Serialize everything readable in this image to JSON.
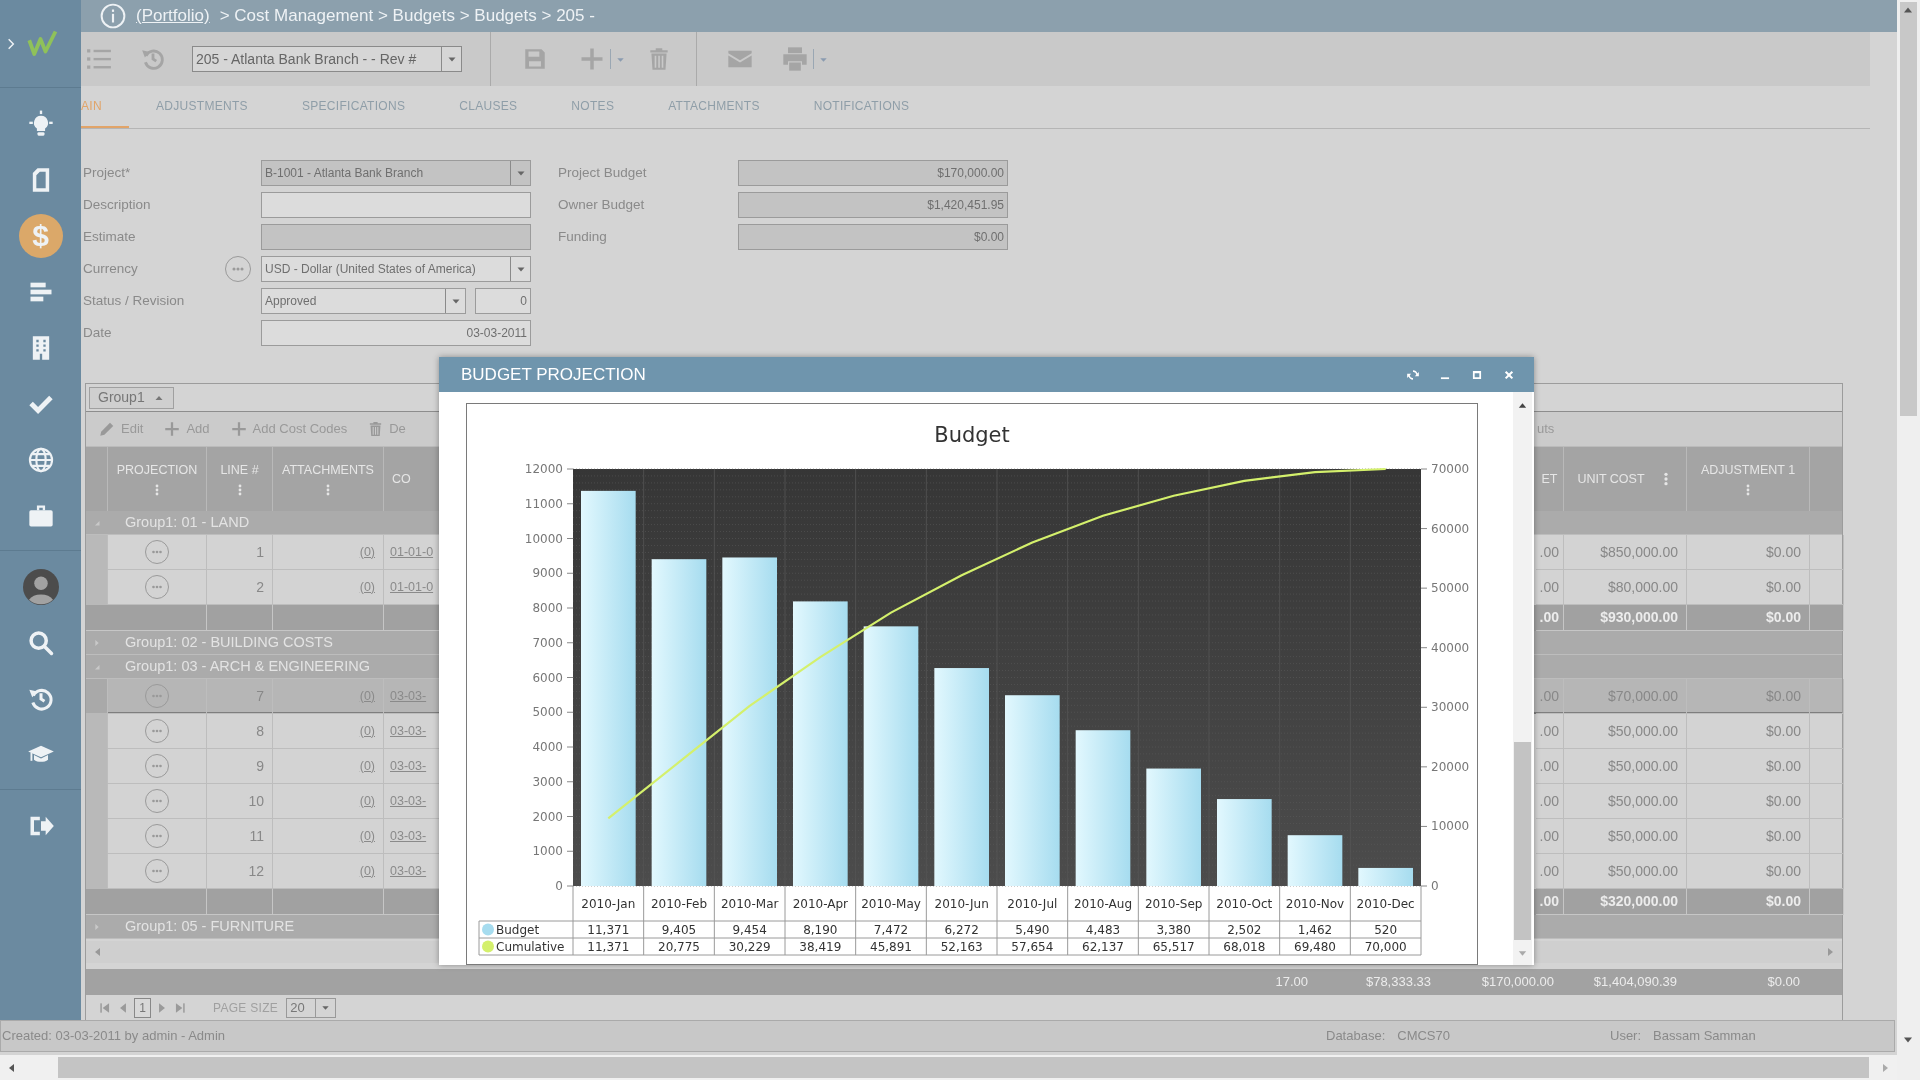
{
  "sidebar": {
    "sections": [
      {
        "items": [
          {
            "kind": "lightbulb",
            "selected": false
          },
          {
            "kind": "document",
            "selected": false
          },
          {
            "kind": "dollar",
            "glyph": "$",
            "selected": true
          },
          {
            "kind": "bars",
            "selected": false
          },
          {
            "kind": "building",
            "selected": false
          },
          {
            "kind": "check",
            "selected": false
          },
          {
            "kind": "globe",
            "selected": false
          },
          {
            "kind": "briefcase",
            "selected": false
          }
        ]
      },
      {
        "items": [
          {
            "kind": "avatar",
            "selected": false
          },
          {
            "kind": "search",
            "selected": false
          },
          {
            "kind": "history",
            "selected": false
          },
          {
            "kind": "cap",
            "selected": false
          }
        ]
      },
      {
        "items": [
          {
            "kind": "signout",
            "selected": false
          }
        ]
      }
    ]
  },
  "header": {
    "link": "(Portfolio)",
    "trail": "> Cost Management > Budgets > Budgets > 205 -"
  },
  "toolbar": {
    "record": "205 - Atlanta Bank Branch -  - Rev #"
  },
  "tabs": [
    {
      "label": "AIN",
      "selected": true
    },
    {
      "label": "ADJUSTMENTS",
      "selected": false
    },
    {
      "label": "SPECIFICATIONS",
      "selected": false
    },
    {
      "label": "CLAUSES",
      "selected": false
    },
    {
      "label": "NOTES",
      "selected": false
    },
    {
      "label": "ATTACHMENTS",
      "selected": false
    },
    {
      "label": "NOTIFICATIONS",
      "selected": false
    }
  ],
  "form": {
    "left": [
      {
        "label": "Project*",
        "kind": "select",
        "value": "B-1001 - Atlanta Bank Branch",
        "disabled": true
      },
      {
        "label": "Description",
        "kind": "text",
        "disabled": false
      },
      {
        "label": "Estimate",
        "kind": "text",
        "disabled": true
      },
      {
        "label": "Currency",
        "kind": "lookup",
        "value": "USD - Dollar (United States of America)",
        "disabled": false
      },
      {
        "label": "Status / Revision",
        "kind": "status",
        "value": "Approved",
        "revision": "0",
        "disabled": false
      },
      {
        "label": "Date",
        "kind": "date",
        "value": "03-03-2011",
        "disabled": false
      }
    ],
    "right": [
      {
        "label": "Project Budget",
        "value": "$170,000.00",
        "disabled": true
      },
      {
        "label": "Owner Budget",
        "value": "$1,420,451.95",
        "disabled": true
      },
      {
        "label": "Funding",
        "value": "$0.00",
        "disabled": true
      }
    ]
  },
  "grid": {
    "group_chip": "Group1",
    "toolbar": [
      {
        "kind": "pencil",
        "label": "Edit"
      },
      {
        "kind": "plus",
        "label": "Add"
      },
      {
        "kind": "plus",
        "label": "Add Cost Codes"
      },
      {
        "kind": "trash",
        "label": "De"
      }
    ],
    "toolbar_right": "uts",
    "columns": [
      {
        "label": "PROJECTION",
        "kind": "stacked"
      },
      {
        "label": "LINE #",
        "kind": "stacked"
      },
      {
        "label": "ATTACHMENTS",
        "kind": "stacked"
      },
      {
        "label": "CO",
        "kind": "plain"
      },
      {
        "label": "ET",
        "kind": "plain"
      },
      {
        "label": "UNIT COST",
        "kind": "inline"
      },
      {
        "label": "ADJUSTMENT 1",
        "kind": "stacked"
      }
    ],
    "rows": [
      {
        "kind": "group",
        "label": "Group1: 01 - LAND",
        "expanded": true
      },
      {
        "kind": "row",
        "line": "1",
        "attachments": "(0)",
        "code": "01-01-0",
        "budget": ".00",
        "unit_cost": "$850,000.00",
        "adjustment": "$0.00",
        "selected": false
      },
      {
        "kind": "row",
        "line": "2",
        "attachments": "(0)",
        "code": "01-01-0",
        "budget": ".00",
        "unit_cost": "$80,000.00",
        "adjustment": "$0.00",
        "selected": false
      },
      {
        "kind": "summary",
        "budget": ".00",
        "unit_cost": "$930,000.00",
        "adjustment": "$0.00"
      },
      {
        "kind": "group",
        "label": "Group1: 02 - BUILDING COSTS",
        "expanded": false
      },
      {
        "kind": "group",
        "label": "Group1: 03 - ARCH & ENGINEERING",
        "expanded": true
      },
      {
        "kind": "row",
        "line": "7",
        "attachments": "(0)",
        "code": "03-03-",
        "budget": ".00",
        "unit_cost": "$70,000.00",
        "adjustment": "$0.00",
        "selected": true
      },
      {
        "kind": "row",
        "line": "8",
        "attachments": "(0)",
        "code": "03-03-",
        "budget": ".00",
        "unit_cost": "$50,000.00",
        "adjustment": "$0.00",
        "selected": false
      },
      {
        "kind": "row",
        "line": "9",
        "attachments": "(0)",
        "code": "03-03-",
        "budget": ".00",
        "unit_cost": "$50,000.00",
        "adjustment": "$0.00",
        "selected": false
      },
      {
        "kind": "row",
        "line": "10",
        "attachments": "(0)",
        "code": "03-03-",
        "budget": ".00",
        "unit_cost": "$50,000.00",
        "adjustment": "$0.00",
        "selected": false
      },
      {
        "kind": "row",
        "line": "11",
        "attachments": "(0)",
        "code": "03-03-",
        "budget": ".00",
        "unit_cost": "$50,000.00",
        "adjustment": "$0.00",
        "selected": false
      },
      {
        "kind": "row",
        "line": "12",
        "attachments": "(0)",
        "code": "03-03-",
        "budget": ".00",
        "unit_cost": "$50,000.00",
        "adjustment": "$0.00",
        "selected": false
      },
      {
        "kind": "summary",
        "budget": ".00",
        "unit_cost": "$320,000.00",
        "adjustment": "$0.00"
      },
      {
        "kind": "group",
        "label": "Group1: 05 - FURNITURE",
        "expanded": false
      }
    ],
    "totals": [
      "17.00",
      "$78,333.33",
      "$170,000.00",
      "$1,404,090.39",
      "$0.00"
    ],
    "pager": {
      "page": "1",
      "page_size_label": "PAGE SIZE",
      "page_size": "20"
    }
  },
  "popup": {
    "title": "BUDGET PROJECTION",
    "chart": {
      "chart_data": {
        "type": "bar",
        "title": "Budget",
        "categories": [
          "2010-Jan",
          "2010-Feb",
          "2010-Mar",
          "2010-Apr",
          "2010-May",
          "2010-Jun",
          "2010-Jul",
          "2010-Aug",
          "2010-Sep",
          "2010-Oct",
          "2010-Nov",
          "2010-Dec"
        ],
        "series": [
          {
            "name": "Budget",
            "color": "#a6dcef",
            "values": [
              11371,
              9405,
              9454,
              8190,
              7472,
              6272,
              5490,
              4483,
              3380,
              2502,
              1462,
              520
            ],
            "value_labels": [
              "11,371",
              "9,405",
              "9,454",
              "8,190",
              "7,472",
              "6,272",
              "5,490",
              "4,483",
              "3,380",
              "2,502",
              "1,462",
              "520"
            ]
          }
        ],
        "ylim": [
          0,
          12000
        ],
        "yticks": [
          0,
          1000,
          2000,
          3000,
          4000,
          5000,
          6000,
          7000,
          8000,
          9000,
          10000,
          11000,
          12000
        ]
      }
    },
    "cumulative": {
      "chart_data": {
        "type": "line",
        "series": [
          {
            "name": "Cumulative",
            "color": "#d4f06c",
            "values": [
              11371,
              20775,
              30229,
              38419,
              45891,
              52163,
              57654,
              62137,
              65517,
              68018,
              69480,
              70000
            ],
            "value_labels": [
              "11,371",
              "20,775",
              "30,229",
              "38,419",
              "45,891",
              "52,163",
              "57,654",
              "62,137",
              "65,517",
              "68,018",
              "69,480",
              "70,000"
            ]
          }
        ],
        "ylim": [
          0,
          70000
        ],
        "yticks": [
          0,
          10000,
          20000,
          30000,
          40000,
          50000,
          60000,
          70000
        ]
      }
    }
  },
  "status_bar": {
    "created": "Created:  03-03-2011 by admin - Admin",
    "database_label": "Database:",
    "database": "CMCS70",
    "user_label": "User:",
    "user": "Bassam Samman"
  }
}
